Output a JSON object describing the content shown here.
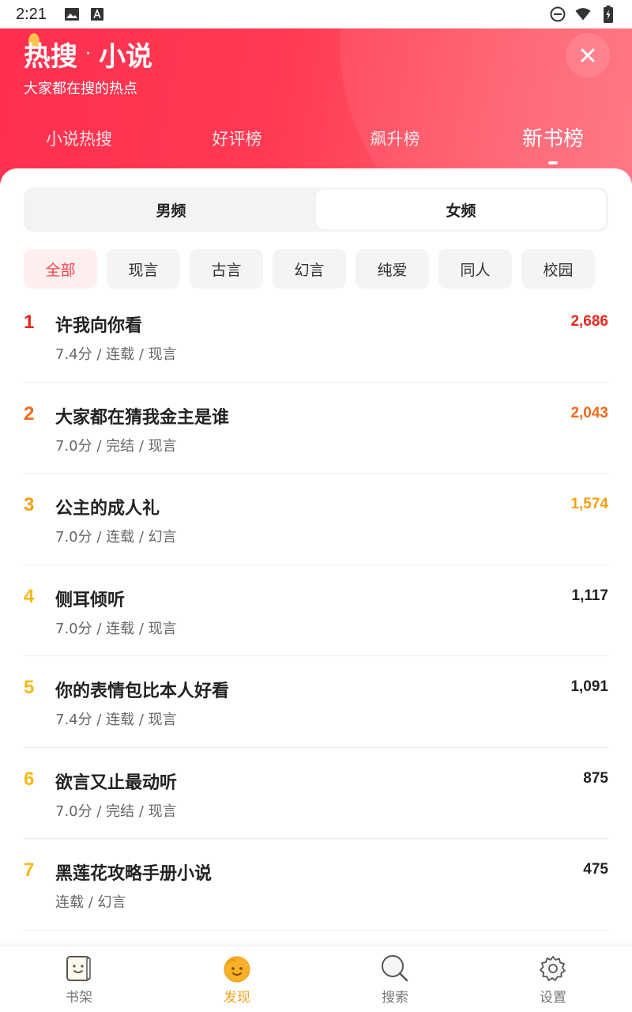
{
  "status_bar": {
    "time": "2:21",
    "icons": [
      "image-icon",
      "font-icon",
      "do-not-disturb-icon",
      "wifi-icon",
      "battery-icon"
    ]
  },
  "header": {
    "title_main": "热搜",
    "title_sep": "·",
    "title_sub": "小说",
    "subtitle": "大家都在搜的热点",
    "close_icon": "close-icon",
    "tabs": [
      {
        "label": "小说热搜"
      },
      {
        "label": "好评榜"
      },
      {
        "label": "飙升榜"
      },
      {
        "label": "新书榜",
        "active": true
      }
    ]
  },
  "gender_tabs": [
    {
      "label": "男频"
    },
    {
      "label": "女频",
      "active": true
    }
  ],
  "categories": [
    {
      "label": "全部",
      "active": true
    },
    {
      "label": "现言"
    },
    {
      "label": "古言"
    },
    {
      "label": "幻言"
    },
    {
      "label": "纯爱"
    },
    {
      "label": "同人"
    },
    {
      "label": "校园"
    }
  ],
  "books": [
    {
      "rank": "1",
      "title": "许我向你看",
      "meta": "7.4分 / 连载 / 现言",
      "count": "2,686"
    },
    {
      "rank": "2",
      "title": "大家都在猜我金主是谁",
      "meta": "7.0分 / 完结 / 现言",
      "count": "2,043"
    },
    {
      "rank": "3",
      "title": "公主的成人礼",
      "meta": "7.0分 / 连载 / 幻言",
      "count": "1,574"
    },
    {
      "rank": "4",
      "title": "侧耳倾听",
      "meta": "7.0分 / 连载 / 现言",
      "count": "1,117"
    },
    {
      "rank": "5",
      "title": "你的表情包比本人好看",
      "meta": "7.4分 / 连载 / 现言",
      "count": "1,091"
    },
    {
      "rank": "6",
      "title": "欲言又止最动听",
      "meta": "7.0分 / 完结 / 现言",
      "count": "875"
    },
    {
      "rank": "7",
      "title": "黑莲花攻略手册小说",
      "meta": "连载 / 幻言",
      "count": "475"
    }
  ],
  "colors": {
    "header_gradient_start": "#ff2f4f",
    "header_gradient_end": "#ff6f7d",
    "rank1": "#e8281e",
    "rank2": "#f06a1c",
    "rank3": "#f5a016",
    "rank_other": "#f6b818",
    "count1": "#e8281e",
    "count2": "#f06a1c",
    "count3": "#f5a016",
    "nav_active": "#f2a122"
  },
  "bottom_nav": [
    {
      "label": "书架",
      "icon": "bookshelf-icon"
    },
    {
      "label": "发现",
      "icon": "discover-icon",
      "active": true
    },
    {
      "label": "搜索",
      "icon": "search-icon"
    },
    {
      "label": "设置",
      "icon": "settings-icon"
    }
  ]
}
